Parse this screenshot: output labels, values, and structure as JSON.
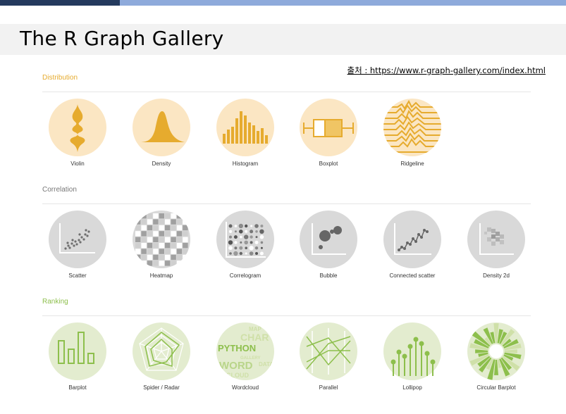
{
  "header": {
    "title": "The R Graph Gallery",
    "source_text": "출처 : https://www.r-graph-gallery.com/index.html"
  },
  "colors": {
    "distribution_accent": "#e6ab2e",
    "distribution_bg": "#fbe6c3",
    "correlation_accent": "#777777",
    "correlation_bg": "#d9d9d9",
    "ranking_accent": "#8dbf4c",
    "ranking_bg": "#e3eccf"
  },
  "sections": [
    {
      "title": "Distribution",
      "items": [
        {
          "label": "Violin",
          "icon": "violin-icon"
        },
        {
          "label": "Density",
          "icon": "density-icon"
        },
        {
          "label": "Histogram",
          "icon": "histogram-icon"
        },
        {
          "label": "Boxplot",
          "icon": "boxplot-icon"
        },
        {
          "label": "Ridgeline",
          "icon": "ridgeline-icon"
        }
      ]
    },
    {
      "title": "Correlation",
      "items": [
        {
          "label": "Scatter",
          "icon": "scatter-icon"
        },
        {
          "label": "Heatmap",
          "icon": "heatmap-icon"
        },
        {
          "label": "Correlogram",
          "icon": "correlogram-icon"
        },
        {
          "label": "Bubble",
          "icon": "bubble-icon"
        },
        {
          "label": "Connected scatter",
          "icon": "connected-scatter-icon"
        },
        {
          "label": "Density 2d",
          "icon": "density-2d-icon"
        }
      ]
    },
    {
      "title": "Ranking",
      "items": [
        {
          "label": "Barplot",
          "icon": "barplot-icon"
        },
        {
          "label": "Spider / Radar",
          "icon": "spider-radar-icon"
        },
        {
          "label": "Wordcloud",
          "icon": "wordcloud-icon",
          "words": [
            "PYTHON",
            "WORD",
            "CHAR",
            "CLOUD",
            "GALLERY",
            "MAP",
            "DATA"
          ]
        },
        {
          "label": "Parallel",
          "icon": "parallel-icon"
        },
        {
          "label": "Lollipop",
          "icon": "lollipop-icon"
        },
        {
          "label": "Circular Barplot",
          "icon": "circular-barplot-icon"
        }
      ]
    }
  ]
}
